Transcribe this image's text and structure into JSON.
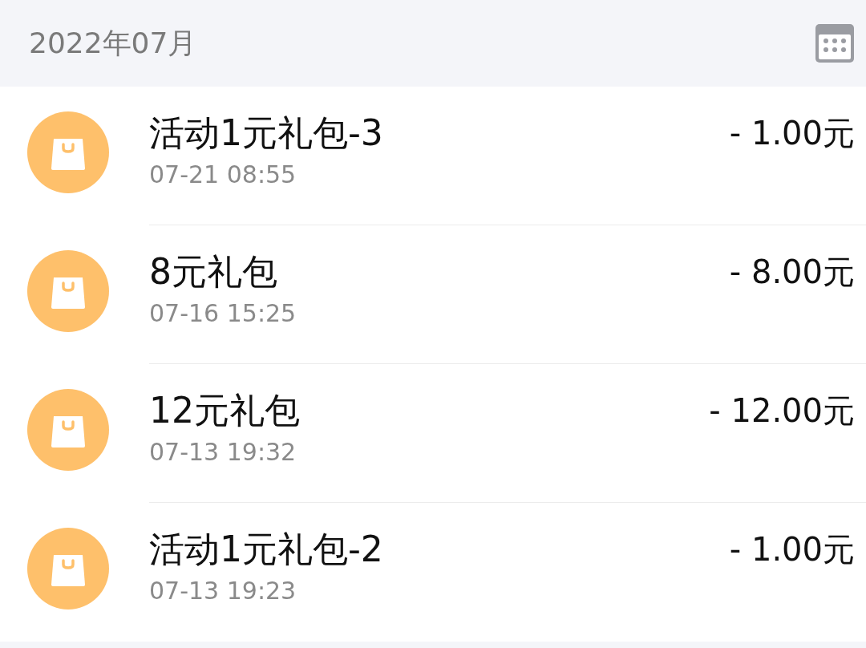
{
  "header": {
    "month": "2022年07月"
  },
  "transactions": [
    {
      "title": "活动1元礼包-3",
      "time": "07-21 08:55",
      "amount": "- 1.00元"
    },
    {
      "title": "8元礼包",
      "time": "07-16 15:25",
      "amount": "- 8.00元"
    },
    {
      "title": "12元礼包",
      "time": "07-13 19:32",
      "amount": "- 12.00元"
    },
    {
      "title": "活动1元礼包-2",
      "time": "07-13 19:23",
      "amount": "- 1.00元"
    }
  ]
}
